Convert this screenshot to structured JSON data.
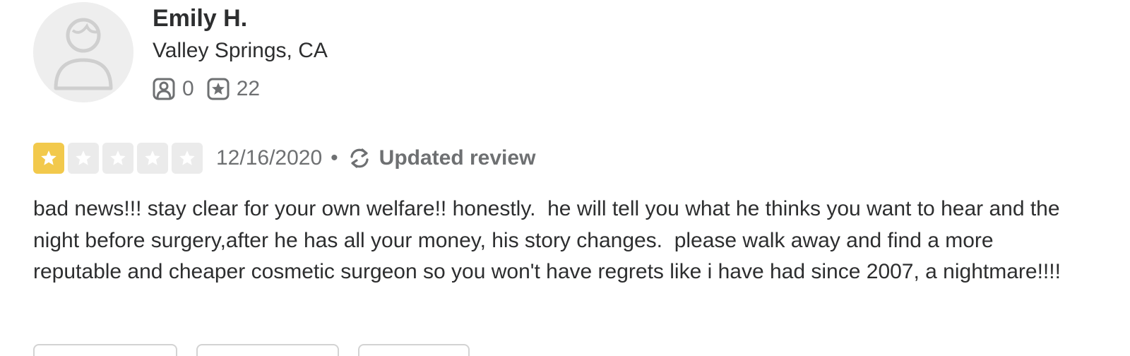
{
  "user": {
    "name": "Emily H.",
    "location": "Valley Springs, CA",
    "friends_count": "0",
    "reviews_count": "22"
  },
  "review": {
    "rating": 1,
    "max_rating": 5,
    "date": "12/16/2020",
    "separator": "•",
    "updated_label": "Updated review",
    "text": "bad news!!! stay clear for your own welfare!! honestly.  he will tell you what he thinks you want to hear and the night before surgery,after he has all your money, his story changes.  please walk away and find a more reputable and cheaper cosmetic surgeon so you won't have regrets like i have had since 2007, a nightmare!!!!"
  },
  "icons": {
    "avatar": "default-user-avatar",
    "friends": "friends-icon",
    "reviews": "reviews-icon",
    "star": "star-icon",
    "updated": "refresh-icon"
  },
  "colors": {
    "star_filled": "#f2c94c",
    "star_empty": "#ebebeb",
    "text_primary": "#2d2e2f",
    "text_secondary": "#6e7072"
  }
}
